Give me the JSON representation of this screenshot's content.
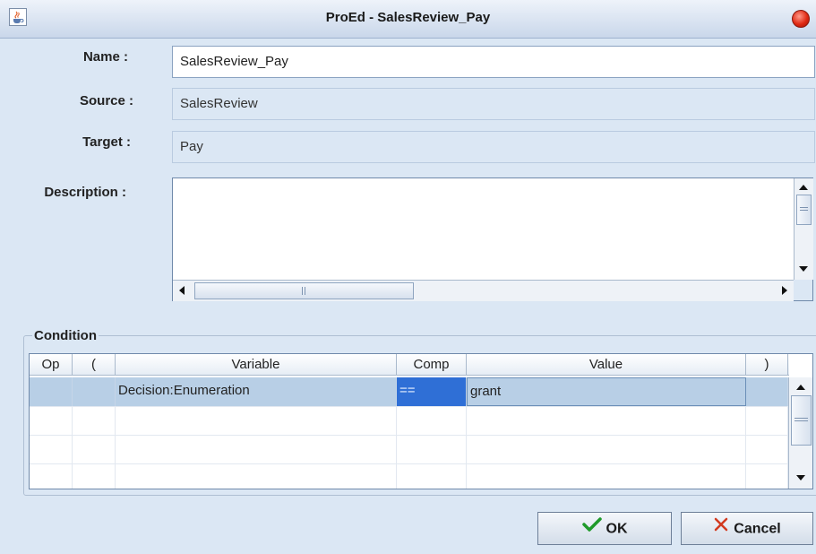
{
  "window": {
    "title": "ProEd - SalesReview_Pay",
    "icon": "java-cup-icon"
  },
  "form": {
    "name_label": "Name :",
    "name_value": "SalesReview_Pay",
    "source_label": "Source :",
    "source_value": "SalesReview",
    "target_label": "Target :",
    "target_value": "Pay",
    "description_label": "Description :",
    "description_value": ""
  },
  "condition": {
    "group_title": "Condition",
    "columns": [
      "Op",
      "(",
      "Variable",
      "Comp",
      "Value",
      ")"
    ],
    "rows": [
      {
        "op": "",
        "open": "",
        "variable": "Decision:Enumeration",
        "comp": "==",
        "value": "grant",
        "close": "",
        "selected": true
      },
      {
        "op": "",
        "open": "",
        "variable": "",
        "comp": "",
        "value": "",
        "close": "",
        "selected": false
      },
      {
        "op": "",
        "open": "",
        "variable": "",
        "comp": "",
        "value": "",
        "close": "",
        "selected": false
      },
      {
        "op": "",
        "open": "",
        "variable": "",
        "comp": "",
        "value": "",
        "close": "",
        "selected": false
      }
    ]
  },
  "buttons": {
    "ok_label": "OK",
    "cancel_label": "Cancel"
  },
  "colors": {
    "window_bg": "#dbe7f4",
    "selection": "#b8cfe6",
    "comp_highlight": "#2f6fd6",
    "ok_icon": "#1f9a2a",
    "cancel_icon": "#d23a1f"
  }
}
